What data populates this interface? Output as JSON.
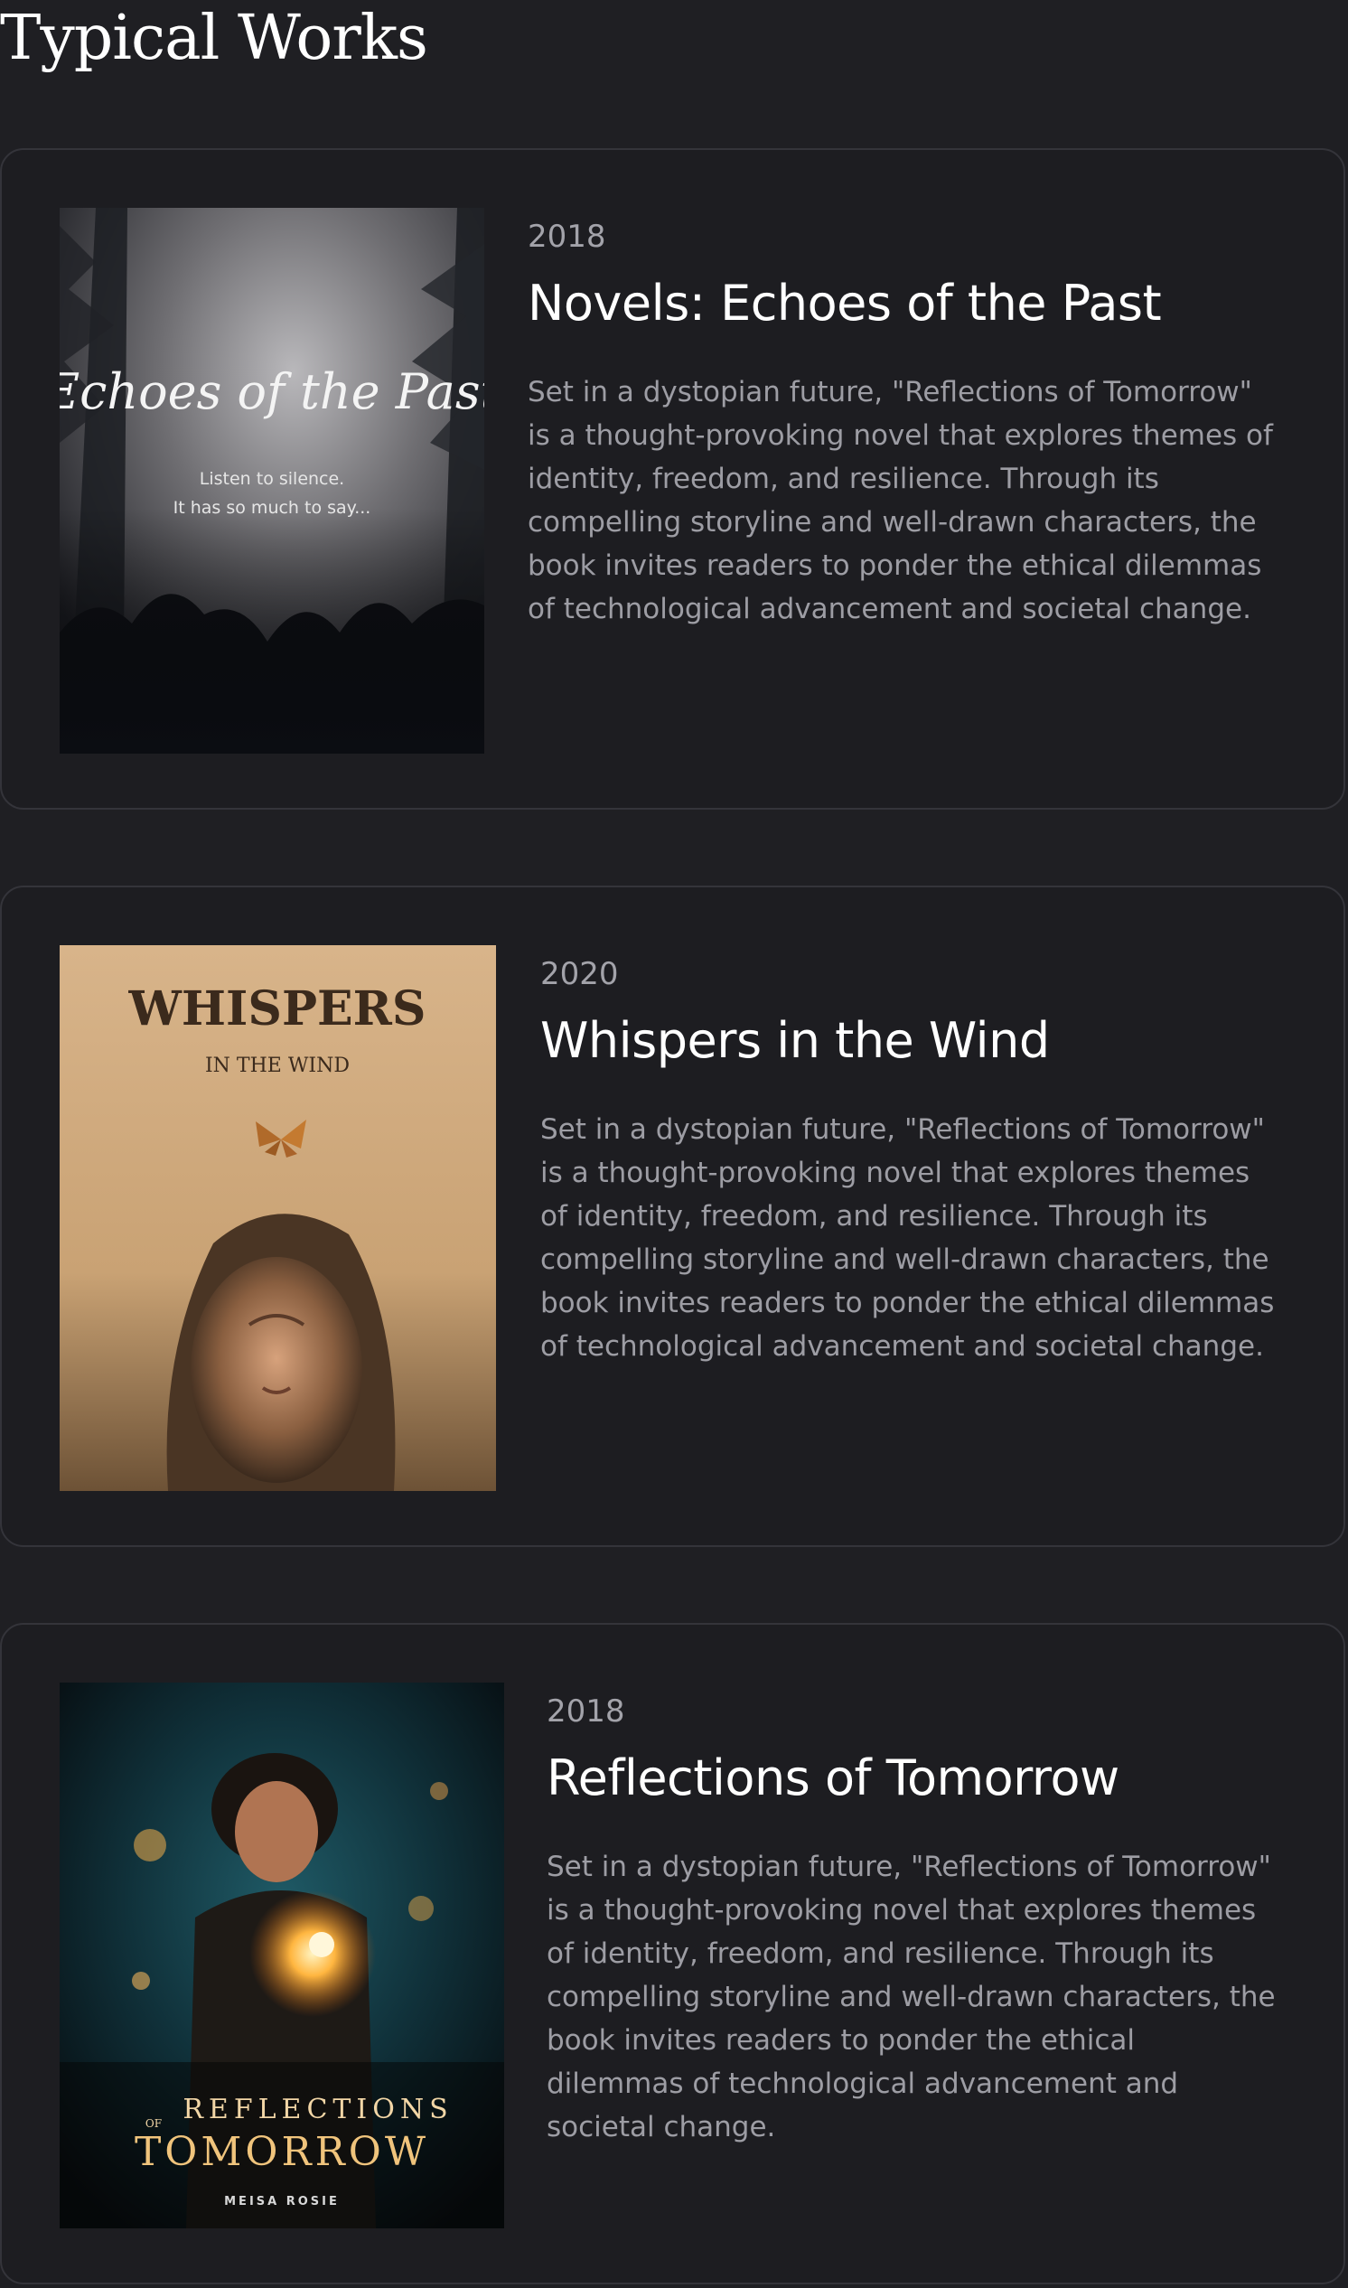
{
  "section": {
    "title": "Typical Works"
  },
  "works": [
    {
      "year": "2018",
      "title": "Novels: Echoes of the Past",
      "description": "Set in a dystopian future, \"Reflections of Tomorrow\" is a thought-provoking novel that explores themes of identity, freedom, and resilience. Through its compelling storyline and well-drawn characters, the book invites readers to ponder the ethical dilemmas of technological advancement and societal change.",
      "cover": {
        "title": "Echoes of the Past",
        "tagline_1": "Listen to silence.",
        "tagline_2": "It has so much to say..."
      }
    },
    {
      "year": "2020",
      "title": "Whispers in the Wind",
      "description": "Set in a dystopian future, \"Reflections of Tomorrow\" is a thought-provoking novel that explores themes of identity, freedom, and resilience. Through its compelling storyline and well-drawn characters, the book invites readers to ponder the ethical dilemmas of technological advancement and societal change.",
      "cover": {
        "title": "WHISPERS",
        "subtitle": "IN THE WIND"
      }
    },
    {
      "year": "2018",
      "title": "Reflections of Tomorrow",
      "description": "Set in a dystopian future, \"Reflections of Tomorrow\" is a thought-provoking novel that explores themes of identity, freedom, and resilience. Through its compelling storyline and well-drawn characters, the book invites readers to ponder the ethical dilemmas of technological advancement and societal change.",
      "cover": {
        "word_1": "REFLECTIONS",
        "word_of": "OF",
        "word_2": "TOMORROW",
        "author": "MEISA ROSIE"
      }
    }
  ]
}
